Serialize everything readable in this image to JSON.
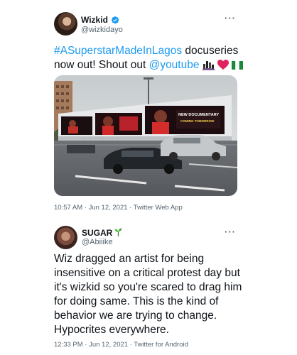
{
  "tweet1": {
    "display_name": "Wizkid",
    "handle": "@wizkidayo",
    "verified": true,
    "hashtag": "#ASuperstarMadeInLagos",
    "text_after_hashtag": " docuseries now out! Shout out ",
    "mention": "@youtube",
    "emojis": [
      "city-skyline-emoji",
      "red-heart-emoji",
      "nigeria-flag-emoji"
    ],
    "image_alt": "Billboard photo",
    "billboard_text": {
      "panel_top": "NEW DOCUMENTARY",
      "panel_bottom": "COMING TOMORROW"
    },
    "timestamp": "10:57 AM · Jun 12, 2021 · Twitter Web App"
  },
  "tweet2": {
    "display_name": "SUGAR",
    "handle": "@Abiiike",
    "name_emoji": "plant-emoji",
    "text": "Wiz dragged an artist for being insensitive on a critical protest day but it's wizkid so you're scared to drag him for doing same. This is the kind of behavior we are trying to change. Hypocrites everywhere.",
    "timestamp": "12:33 PM · Jun 12, 2021 · Twitter for Android"
  },
  "more_label": "···",
  "colors": {
    "link": "#1d9bf0",
    "text": "#0f1419",
    "secondary": "#536471",
    "verified": "#1d9bf0"
  }
}
